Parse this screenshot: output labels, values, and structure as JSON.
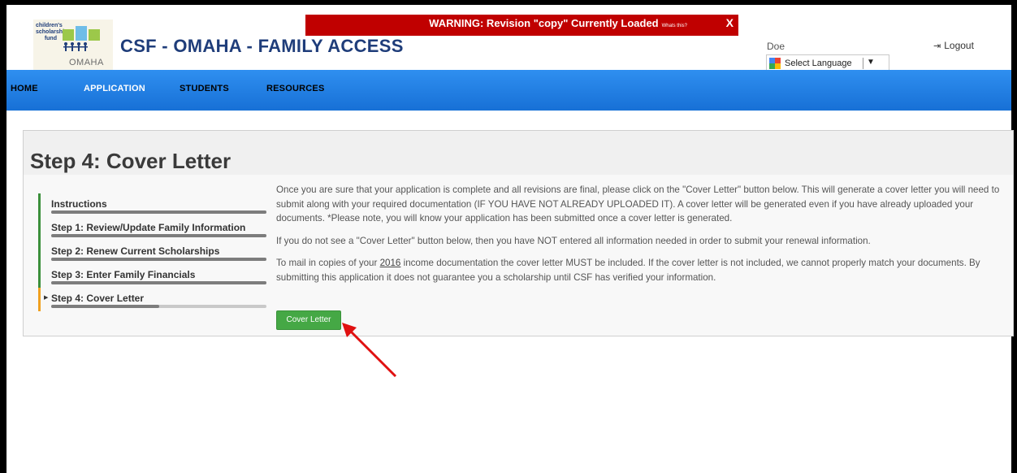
{
  "warning": {
    "message": "WARNING: Revision \"copy\" Currently Loaded",
    "whats_this": "Whats this?",
    "close": "X"
  },
  "header": {
    "logo_line1": "children's",
    "logo_line2": "scholarship",
    "logo_line3": "fund",
    "logo_city": "OMAHA",
    "title": "CSF - OMAHA - FAMILY ACCESS",
    "user": "Doe",
    "language": "Select Language",
    "language_arrow": "▼",
    "logout": "Logout"
  },
  "nav": {
    "items": [
      "HOME",
      "APPLICATION",
      "STUDENTS",
      "RESOURCES"
    ],
    "active": "APPLICATION"
  },
  "page": {
    "title": "Step 4: Cover Letter"
  },
  "steps": [
    {
      "label": "Instructions",
      "progress": 1.0,
      "current": false
    },
    {
      "label": "Step 1: Review/Update Family Information",
      "progress": 1.0,
      "current": false
    },
    {
      "label": "Step 2: Renew Current Scholarships",
      "progress": 1.0,
      "current": false
    },
    {
      "label": "Step 3: Enter Family Financials",
      "progress": 1.0,
      "current": false
    },
    {
      "label": "Step 4: Cover Letter",
      "progress": 0.5,
      "current": true
    }
  ],
  "content": {
    "para1": "Once you are sure that your application is complete and all revisions are final, please click on the \"Cover Letter\" button below. This will generate a cover letter you will need to submit along with your required documentation (IF YOU HAVE NOT ALREADY UPLOADED IT). A cover letter will be generated even if you have already uploaded your documents. *Please note, you will know your application has been submitted once a cover letter is generated.",
    "para2": "If you do not see a \"Cover Letter\" button below, then you have NOT entered all information needed in order to submit your renewal information.",
    "para3_pre": "To mail in copies of your ",
    "para3_year": "2016",
    "para3_post": " income documentation the cover letter MUST be included. If the cover letter is not included, we cannot properly match your documents.  By submitting this application it does not guarantee you a scholarship until CSF has verified your information."
  },
  "button": {
    "cover_letter": "Cover Letter"
  },
  "colors": {
    "warning_bg": "#c00000",
    "nav_bg": "#1f80e8",
    "button_green": "#45a845",
    "step_done": "#3b8f3b",
    "step_current": "#f0a020",
    "arrow": "#e01010"
  }
}
